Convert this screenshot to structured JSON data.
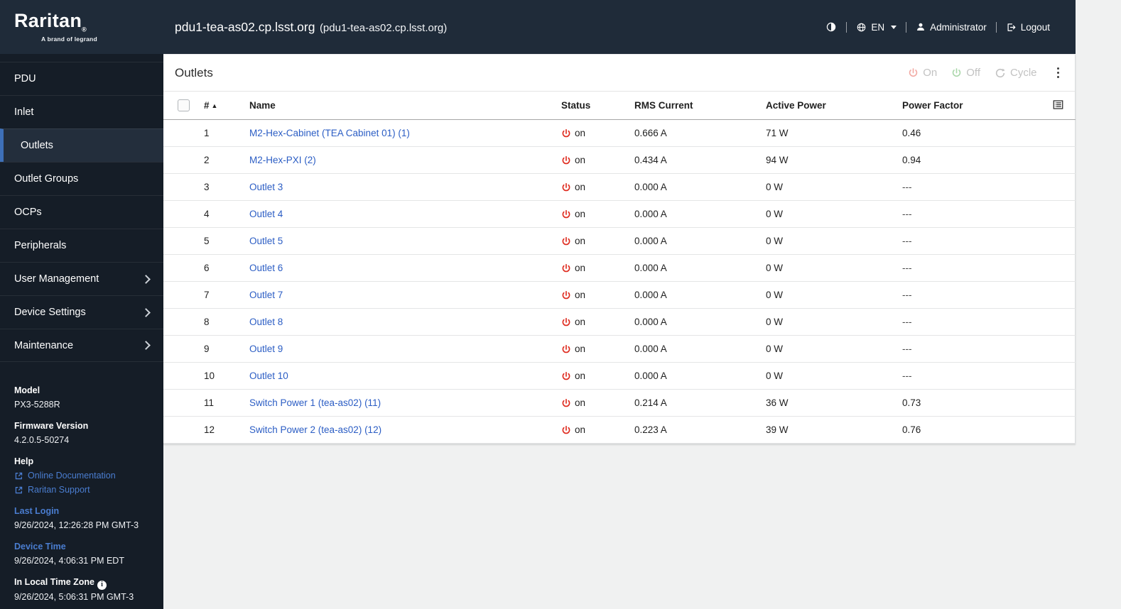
{
  "header": {
    "brand": "Raritan",
    "brand_mark": "®",
    "tagline": "A brand of legrand",
    "device_name": "pdu1-tea-as02.cp.lsst.org",
    "device_name_secondary": "(pdu1-tea-as02.cp.lsst.org)",
    "language": "EN",
    "username": "Administrator",
    "logout_label": "Logout"
  },
  "sidebar": {
    "items": [
      {
        "label": "PDU",
        "active": false,
        "expandable": false
      },
      {
        "label": "Inlet",
        "active": false,
        "expandable": false
      },
      {
        "label": "Outlets",
        "active": true,
        "expandable": false
      },
      {
        "label": "Outlet Groups",
        "active": false,
        "expandable": false
      },
      {
        "label": "OCPs",
        "active": false,
        "expandable": false
      },
      {
        "label": "Peripherals",
        "active": false,
        "expandable": false
      },
      {
        "label": "User Management",
        "active": false,
        "expandable": true
      },
      {
        "label": "Device Settings",
        "active": false,
        "expandable": true
      },
      {
        "label": "Maintenance",
        "active": false,
        "expandable": true
      }
    ],
    "info": {
      "model_label": "Model",
      "model_value": "PX3-5288R",
      "firmware_label": "Firmware Version",
      "firmware_value": "4.2.0.5-50274",
      "help_label": "Help",
      "help_links": [
        "Online Documentation",
        "Raritan Support"
      ],
      "last_login_label": "Last Login",
      "last_login_value": "9/26/2024, 12:26:28 PM GMT-3",
      "device_time_label": "Device Time",
      "device_time_value": "9/26/2024, 4:06:31 PM EDT",
      "local_tz_label": "In Local Time Zone",
      "local_tz_value": "9/26/2024, 5:06:31 PM GMT-3"
    }
  },
  "main": {
    "title": "Outlets",
    "actions": {
      "on_label": "On",
      "off_label": "Off",
      "cycle_label": "Cycle"
    },
    "table": {
      "headers": {
        "num": "#",
        "name": "Name",
        "status": "Status",
        "rms": "RMS Current",
        "power": "Active Power",
        "pf": "Power Factor"
      },
      "sort": {
        "column": "#",
        "direction": "asc"
      },
      "rows": [
        {
          "num": "1",
          "name": "M2-Hex-Cabinet (TEA Cabinet 01) (1)",
          "status": "on",
          "rms": "0.666 A",
          "power": "71 W",
          "pf": "0.46"
        },
        {
          "num": "2",
          "name": "M2-Hex-PXI (2)",
          "status": "on",
          "rms": "0.434 A",
          "power": "94 W",
          "pf": "0.94"
        },
        {
          "num": "3",
          "name": "Outlet 3",
          "status": "on",
          "rms": "0.000 A",
          "power": "0 W",
          "pf": "---"
        },
        {
          "num": "4",
          "name": "Outlet 4",
          "status": "on",
          "rms": "0.000 A",
          "power": "0 W",
          "pf": "---"
        },
        {
          "num": "5",
          "name": "Outlet 5",
          "status": "on",
          "rms": "0.000 A",
          "power": "0 W",
          "pf": "---"
        },
        {
          "num": "6",
          "name": "Outlet 6",
          "status": "on",
          "rms": "0.000 A",
          "power": "0 W",
          "pf": "---"
        },
        {
          "num": "7",
          "name": "Outlet 7",
          "status": "on",
          "rms": "0.000 A",
          "power": "0 W",
          "pf": "---"
        },
        {
          "num": "8",
          "name": "Outlet 8",
          "status": "on",
          "rms": "0.000 A",
          "power": "0 W",
          "pf": "---"
        },
        {
          "num": "9",
          "name": "Outlet 9",
          "status": "on",
          "rms": "0.000 A",
          "power": "0 W",
          "pf": "---"
        },
        {
          "num": "10",
          "name": "Outlet 10",
          "status": "on",
          "rms": "0.000 A",
          "power": "0 W",
          "pf": "---"
        },
        {
          "num": "11",
          "name": "Switch Power 1 (tea-as02) (11)",
          "status": "on",
          "rms": "0.214 A",
          "power": "36 W",
          "pf": "0.73"
        },
        {
          "num": "12",
          "name": "Switch Power 2 (tea-as02) (12)",
          "status": "on",
          "rms": "0.223 A",
          "power": "39 W",
          "pf": "0.76"
        }
      ]
    }
  },
  "icons": {
    "sort_asc": "▲",
    "info": "i"
  },
  "colors": {
    "header_bg": "#1f2b39",
    "sidebar_bg": "#151d27",
    "sidebar_active_bg": "#232e3c",
    "accent_blue": "#3e70b8",
    "sidebar_link_blue": "#4a7dd0",
    "table_link_blue": "#2b5dc4",
    "status_on_red": "#df2b1f",
    "action_on_red": "#f2aaa4",
    "action_off_green": "#abd7ab",
    "disabled_text": "#c2c2c2",
    "page_bg": "#f0f1f1"
  }
}
